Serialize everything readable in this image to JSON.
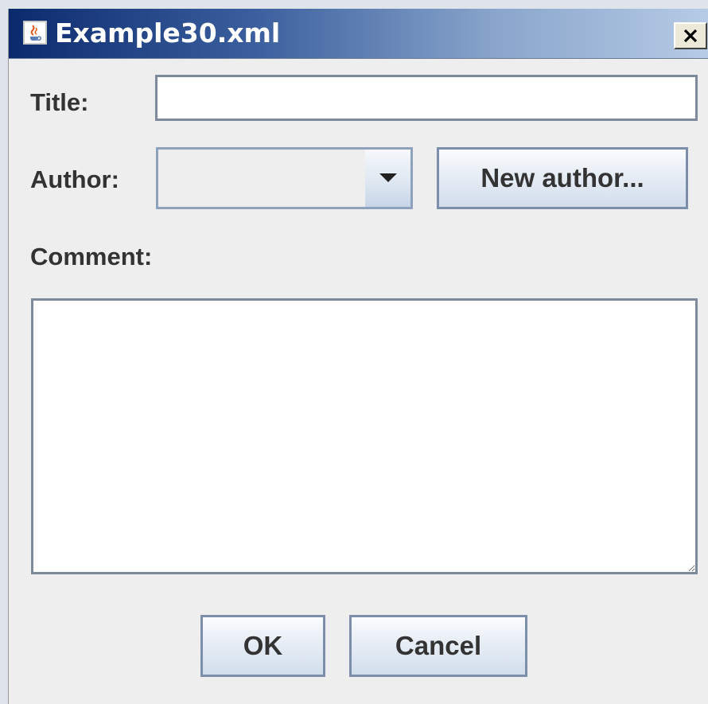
{
  "window": {
    "title": "Example30.xml",
    "close_label": "X"
  },
  "form": {
    "title_label": "Title:",
    "title_value": "",
    "author_label": "Author:",
    "author_value": "",
    "new_author_label": "New author...",
    "comment_label": "Comment:",
    "comment_value": ""
  },
  "buttons": {
    "ok_label": "OK",
    "cancel_label": "Cancel"
  },
  "icons": {
    "app": "java-coffee-cup-icon",
    "close": "close-icon",
    "dropdown": "triangle-down-icon"
  },
  "colors": {
    "titlebar_start": "#0b2a6e",
    "titlebar_end": "#b6cbe6",
    "window_bg": "#eeeeee",
    "field_border": "#7d8a9c"
  }
}
